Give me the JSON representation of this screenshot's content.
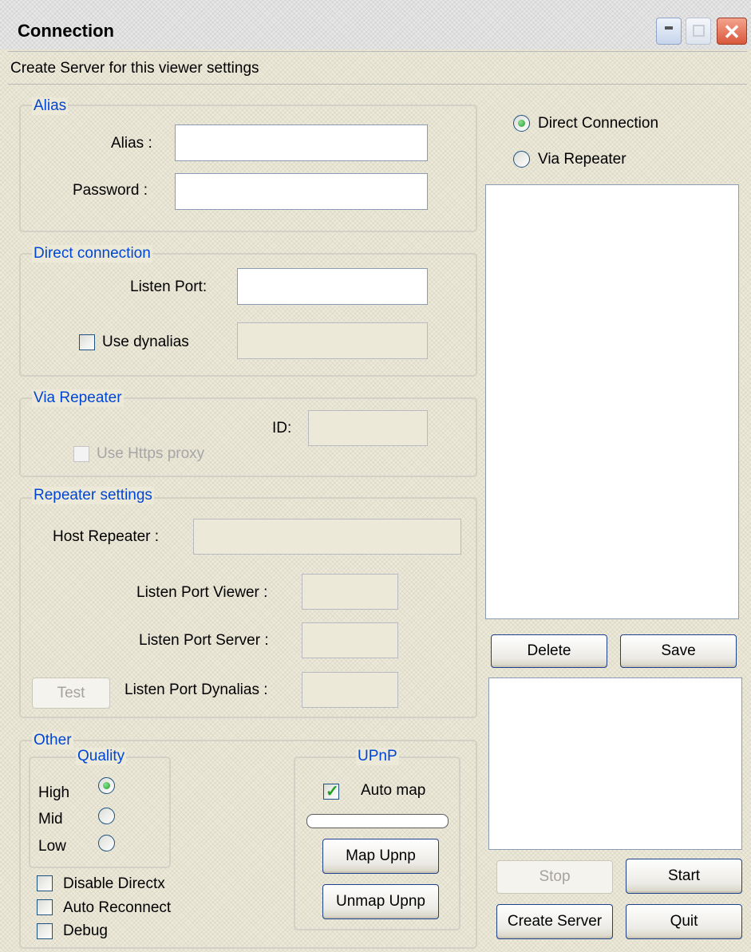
{
  "window": {
    "title": "Connection",
    "subtitle": "Create Server for this viewer settings"
  },
  "alias_group": {
    "legend": "Alias",
    "alias_label": "Alias :",
    "alias_value": "",
    "password_label": "Password :",
    "password_value": ""
  },
  "direct_group": {
    "legend": "Direct connection",
    "listen_port_label": "Listen Port:",
    "listen_port_value": "",
    "use_dynalias_label": "Use dynalias",
    "use_dynalias_checked": false
  },
  "via_repeater_group": {
    "legend": "Via Repeater",
    "id_label": "ID:",
    "use_https_label": "Use Https proxy",
    "use_https_checked": false
  },
  "repeater_settings": {
    "legend": "Repeater settings",
    "host_label": "Host Repeater :",
    "listen_port_viewer_label": "Listen Port Viewer :",
    "listen_port_server_label": "Listen Port Server :",
    "listen_port_dynalias_label": "Listen Port Dynalias :",
    "test_button": "Test"
  },
  "other_group": {
    "legend": "Other",
    "quality": {
      "legend": "Quality",
      "options": [
        "High",
        "Mid",
        "Low"
      ],
      "selected": "High"
    },
    "upnp": {
      "legend": "UPnP",
      "auto_map_label": "Auto map",
      "auto_map_checked": true,
      "map_button": "Map Upnp",
      "unmap_button": "Unmap Upnp"
    },
    "disable_directx_label": "Disable Directx",
    "auto_reconnect_label": "Auto Reconnect",
    "debug_label": "Debug"
  },
  "connection_mode": {
    "options": [
      "Direct Connection",
      "Via Repeater"
    ],
    "selected": "Direct Connection"
  },
  "buttons": {
    "delete": "Delete",
    "save": "Save",
    "stop": "Stop",
    "start": "Start",
    "create_server": "Create Server",
    "quit": "Quit"
  },
  "colors": {
    "group_legend": "#0046d5",
    "window_bg": "#ece9d8",
    "close_button": "#d8573c"
  }
}
